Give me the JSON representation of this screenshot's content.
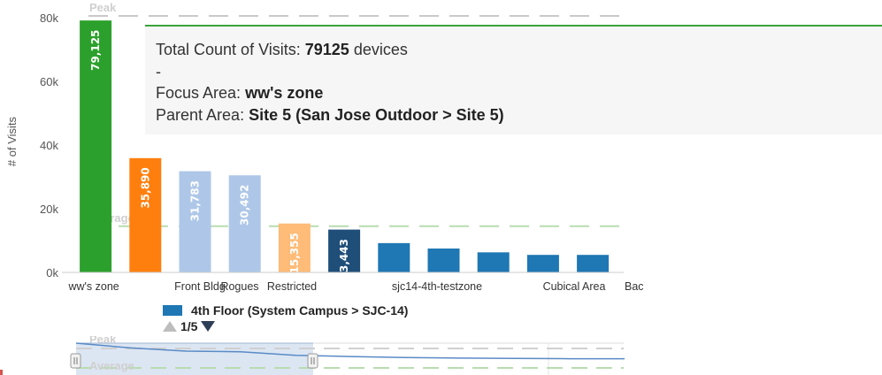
{
  "chart_data": {
    "type": "bar",
    "ylabel": "# of Visits",
    "ylim": [
      0,
      80000
    ],
    "yticks": [
      "0k",
      "20k",
      "40k",
      "60k",
      "80k"
    ],
    "yticks_values": [
      0,
      20000,
      40000,
      60000,
      80000
    ],
    "grid": false,
    "categories": [
      "ww's zone",
      "",
      "Front Bldg",
      "Rogues",
      "Restricted",
      "",
      "sjc14-4th-testzone",
      "",
      "",
      "Cubical Area",
      "Bac"
    ],
    "values": [
      79125,
      35890,
      31783,
      30492,
      15355,
      13443,
      9200,
      7500,
      6300,
      5500,
      5500
    ],
    "data_labels": [
      "79,125",
      "35,890",
      "31,783",
      "30,492",
      "15,355",
      "13,443",
      "",
      "",
      "",
      "",
      ""
    ],
    "bar_colors": [
      "#2ca02c",
      "#ff7f0e",
      "#aec7e8",
      "#aec7e8",
      "#ffbb78",
      "#1f4e79",
      "#1f77b4",
      "#1f77b4",
      "#1f77b4",
      "#1f77b4",
      "#1f77b4"
    ],
    "reference_lines": [
      {
        "label": "Peak",
        "value": 80000,
        "color": "#c9c9c9"
      },
      {
        "label": "Average",
        "value": 14500,
        "color": "#b8dcb0"
      }
    ],
    "legend": [
      {
        "label": "4th Floor (System Campus > SJC-14)",
        "color": "#1f77b4"
      }
    ],
    "legend_pager": "1/5",
    "navigator_labels": [
      "Peak",
      "Average"
    ],
    "navigator_series": [
      100,
      85,
      75,
      73,
      62,
      58,
      55,
      53,
      52,
      51,
      51
    ]
  },
  "tooltip": {
    "line1_label": "Total Count of Visits: ",
    "line1_value": "79125",
    "line1_suffix": " devices",
    "line2": "-",
    "line3_label": "Focus Area: ",
    "line3_value": "ww's zone",
    "line4_label": "Parent Area: ",
    "line4_value": "Site 5 (San Jose Outdoor > Site 5)"
  }
}
